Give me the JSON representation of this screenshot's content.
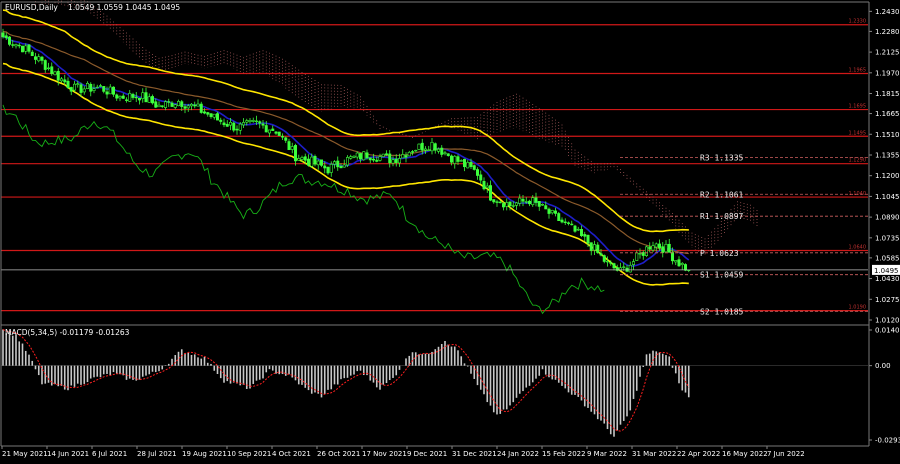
{
  "chart_data": [
    {
      "type": "candlestick",
      "title": "EURUSD,Daily",
      "ohlc_text": "1.0549 1.0559 1.0445 1.0495",
      "current_price": "1.0495",
      "y_ticks": [
        "1.2430",
        "1.2280",
        "1.2125",
        "1.1970",
        "1.1815",
        "1.1665",
        "1.1510",
        "1.1355",
        "1.1200",
        "1.1045",
        "1.0890",
        "1.0735",
        "1.0585",
        "1.0430",
        "1.0275",
        "1.0120"
      ],
      "y_tick_values": [
        1.243,
        1.228,
        1.2125,
        1.197,
        1.1815,
        1.1665,
        1.151,
        1.1355,
        1.12,
        1.1045,
        1.089,
        1.0735,
        1.0585,
        1.043,
        1.0275,
        1.012
      ],
      "ylim": [
        1.012,
        1.25
      ],
      "x_ticks": [
        "21 May 2021",
        "14 Jun 2021",
        "6 Jul 2021",
        "28 Jul 2021",
        "19 Aug 2021",
        "10 Sep 2021",
        "4 Oct 2021",
        "26 Oct 2021",
        "17 Nov 2021",
        "9 Dec 2021",
        "31 Dec 2021",
        "24 Jan 2022",
        "15 Feb 2022",
        "9 Mar 2022",
        "31 Mar 2022",
        "22 Apr 2022",
        "16 May 2022",
        "7 Jun 2022"
      ],
      "levels": [
        {
          "price": 1.233,
          "tag": "1.2330"
        },
        {
          "price": 1.1965,
          "tag": "1.1965"
        },
        {
          "price": 1.1695,
          "tag": "1.1695"
        },
        {
          "price": 1.1495,
          "tag": "1.1495"
        },
        {
          "price": 1.129,
          "tag": "1.1290"
        },
        {
          "price": 1.104,
          "tag": "1.1040"
        },
        {
          "price": 1.064,
          "tag": "1.0640"
        },
        {
          "price": 1.019,
          "tag": "1.0190"
        }
      ],
      "pivots": [
        {
          "label": "R3 1.1335",
          "price": 1.1335
        },
        {
          "label": "R2 1.1061",
          "price": 1.1061
        },
        {
          "label": "R1 1.0897",
          "price": 1.0897
        },
        {
          "label": "P 1.0623",
          "price": 1.0623
        },
        {
          "label": "S1 1.0459",
          "price": 1.0459
        },
        {
          "label": "S2 1.0185",
          "price": 1.0185
        }
      ],
      "close_anchors": [
        [
          0,
          1.224
        ],
        [
          6,
          1.216
        ],
        [
          12,
          1.205
        ],
        [
          18,
          1.192
        ],
        [
          22,
          1.185
        ],
        [
          30,
          1.186
        ],
        [
          36,
          1.179
        ],
        [
          42,
          1.18
        ],
        [
          48,
          1.172
        ],
        [
          54,
          1.176
        ],
        [
          60,
          1.17
        ],
        [
          66,
          1.162
        ],
        [
          72,
          1.156
        ],
        [
          78,
          1.159
        ],
        [
          84,
          1.154
        ],
        [
          90,
          1.135
        ],
        [
          96,
          1.129
        ],
        [
          100,
          1.125
        ],
        [
          106,
          1.132
        ],
        [
          112,
          1.136
        ],
        [
          120,
          1.132
        ],
        [
          126,
          1.14
        ],
        [
          132,
          1.144
        ],
        [
          138,
          1.134
        ],
        [
          146,
          1.122
        ],
        [
          150,
          1.105
        ],
        [
          156,
          1.098
        ],
        [
          162,
          1.102
        ],
        [
          168,
          1.092
        ],
        [
          174,
          1.082
        ],
        [
          180,
          1.07
        ],
        [
          186,
          1.054
        ],
        [
          190,
          1.048
        ],
        [
          194,
          1.056
        ],
        [
          200,
          1.07
        ],
        [
          204,
          1.065
        ],
        [
          208,
          1.055
        ],
        [
          211,
          1.0495
        ]
      ]
    },
    {
      "type": "bar",
      "title": "MACD(5,34,5) -0.01179 -0.01263",
      "y_ticks": [
        "0.01406",
        "0.00",
        "-0.02935"
      ],
      "y_tick_values": [
        0.01406,
        0.0,
        -0.02935
      ],
      "ylim": [
        -0.02935,
        0.01406
      ],
      "macd_anchors": [
        [
          0,
          0.014
        ],
        [
          4,
          0.012
        ],
        [
          8,
          0.004
        ],
        [
          12,
          -0.007
        ],
        [
          20,
          -0.009
        ],
        [
          28,
          -0.005
        ],
        [
          34,
          -0.003
        ],
        [
          40,
          -0.006
        ],
        [
          48,
          -0.002
        ],
        [
          55,
          0.006
        ],
        [
          62,
          0.003
        ],
        [
          68,
          -0.006
        ],
        [
          76,
          -0.009
        ],
        [
          82,
          -0.002
        ],
        [
          88,
          -0.004
        ],
        [
          94,
          -0.01
        ],
        [
          98,
          -0.012
        ],
        [
          104,
          -0.006
        ],
        [
          110,
          -0.002
        ],
        [
          116,
          -0.009
        ],
        [
          120,
          -0.005
        ],
        [
          126,
          0.006
        ],
        [
          130,
          0.004
        ],
        [
          136,
          0.01
        ],
        [
          140,
          0.006
        ],
        [
          146,
          -0.008
        ],
        [
          152,
          -0.02
        ],
        [
          156,
          -0.016
        ],
        [
          160,
          -0.01
        ],
        [
          166,
          -0.002
        ],
        [
          172,
          -0.008
        ],
        [
          178,
          -0.014
        ],
        [
          184,
          -0.022
        ],
        [
          188,
          -0.028
        ],
        [
          193,
          -0.018
        ],
        [
          198,
          0.004
        ],
        [
          201,
          0.006
        ],
        [
          205,
          0.003
        ],
        [
          209,
          -0.01
        ],
        [
          211,
          -0.012
        ]
      ]
    }
  ]
}
